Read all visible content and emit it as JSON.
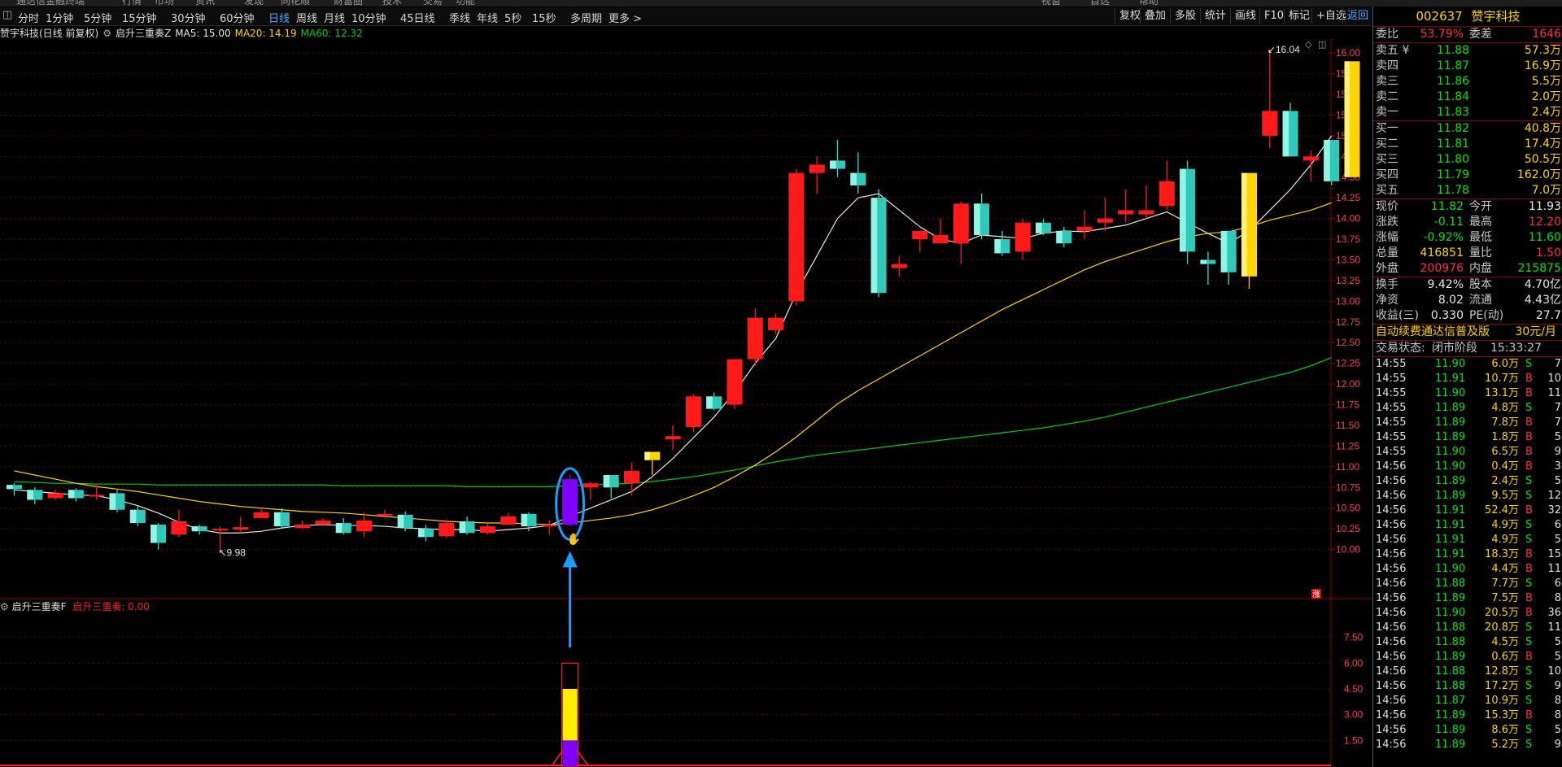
{
  "top_menu": [
    "通达信金融终端",
    "行情",
    "市场",
    "资讯",
    "发现",
    "同花顺",
    "财富圈",
    "技术",
    "交易",
    "功能",
    "视窗",
    "自选",
    "帮助"
  ],
  "toolbar": {
    "tabs": [
      "分时",
      "1分钟",
      "5分钟",
      "15分钟",
      "30分钟",
      "60分钟",
      "日线",
      "周线",
      "月线",
      "10分钟",
      "45日线",
      "季线",
      "年线",
      "5秒",
      "15秒",
      "多周期",
      "更多 >"
    ],
    "active_tab": "日线",
    "right_buttons": [
      "复权",
      "叠加",
      "多股",
      "统计",
      "画线",
      "F10",
      "标记",
      "+自选",
      "返回"
    ],
    "active_right": "返回"
  },
  "chart_info": {
    "stock": "赞宇科技(日线 前复权)",
    "indicator": "启升三重奏Z",
    "ma5": "MA5: 15.00",
    "ma20": "MA20: 14.19",
    "ma60": "MA60: 12.32"
  },
  "sub_info": {
    "name": "启升三重奏F",
    "value": "启升三重奏: 0.00"
  },
  "colors": {
    "up": "#ff1a1a",
    "down": "#33e0c8",
    "signal": "#8000ff",
    "gold": "#ffd400",
    "ma5": "#e8e8e8",
    "ma20": "#ffd400",
    "ma60": "#00d000",
    "highlight": "#1a9fff"
  },
  "chart_data": {
    "type": "candlestick",
    "y_axis_ticks": [
      "16.00",
      "15.75",
      "15.50",
      "15.25",
      "15.00",
      "14.75",
      "14.50",
      "14.25",
      "14.00",
      "13.75",
      "13.50",
      "13.25",
      "13.00",
      "12.75",
      "12.50",
      "12.25",
      "12.00",
      "11.75",
      "11.50",
      "11.25",
      "11.00",
      "10.75",
      "10.50",
      "10.25",
      "10.00"
    ],
    "ylim": [
      9.75,
      16.1
    ],
    "candles": [
      {
        "o": 10.78,
        "h": 10.8,
        "l": 10.65,
        "c": 10.73,
        "k": "down"
      },
      {
        "o": 10.72,
        "h": 10.75,
        "l": 10.55,
        "c": 10.6,
        "k": "down"
      },
      {
        "o": 10.68,
        "h": 10.72,
        "l": 10.6,
        "c": 10.62,
        "k": "up"
      },
      {
        "o": 10.72,
        "h": 10.74,
        "l": 10.58,
        "c": 10.62,
        "k": "down"
      },
      {
        "o": 10.66,
        "h": 10.78,
        "l": 10.6,
        "c": 10.64,
        "k": "up"
      },
      {
        "o": 10.68,
        "h": 10.72,
        "l": 10.45,
        "c": 10.48,
        "k": "down"
      },
      {
        "o": 10.48,
        "h": 10.52,
        "l": 10.28,
        "c": 10.32,
        "k": "down"
      },
      {
        "o": 10.3,
        "h": 10.32,
        "l": 10.0,
        "c": 10.08,
        "k": "down"
      },
      {
        "o": 10.34,
        "h": 10.48,
        "l": 10.15,
        "c": 10.18,
        "k": "up"
      },
      {
        "o": 10.28,
        "h": 10.3,
        "l": 10.18,
        "c": 10.22,
        "k": "down"
      },
      {
        "o": 10.25,
        "h": 10.28,
        "l": 9.98,
        "c": 10.23,
        "k": "up"
      },
      {
        "o": 10.27,
        "h": 10.4,
        "l": 10.2,
        "c": 10.24,
        "k": "up"
      },
      {
        "o": 10.45,
        "h": 10.5,
        "l": 10.38,
        "c": 10.38,
        "k": "up"
      },
      {
        "o": 10.45,
        "h": 10.5,
        "l": 10.25,
        "c": 10.28,
        "k": "down"
      },
      {
        "o": 10.3,
        "h": 10.35,
        "l": 10.25,
        "c": 10.26,
        "k": "up"
      },
      {
        "o": 10.35,
        "h": 10.38,
        "l": 10.3,
        "c": 10.3,
        "k": "up"
      },
      {
        "o": 10.32,
        "h": 10.38,
        "l": 10.18,
        "c": 10.2,
        "k": "down"
      },
      {
        "o": 10.35,
        "h": 10.45,
        "l": 10.15,
        "c": 10.22,
        "k": "up"
      },
      {
        "o": 10.43,
        "h": 10.48,
        "l": 10.38,
        "c": 10.41,
        "k": "up"
      },
      {
        "o": 10.42,
        "h": 10.46,
        "l": 10.22,
        "c": 10.26,
        "k": "down"
      },
      {
        "o": 10.25,
        "h": 10.3,
        "l": 10.1,
        "c": 10.15,
        "k": "down"
      },
      {
        "o": 10.32,
        "h": 10.36,
        "l": 10.14,
        "c": 10.16,
        "k": "up"
      },
      {
        "o": 10.34,
        "h": 10.4,
        "l": 10.18,
        "c": 10.2,
        "k": "down"
      },
      {
        "o": 10.28,
        "h": 10.31,
        "l": 10.18,
        "c": 10.2,
        "k": "up"
      },
      {
        "o": 10.4,
        "h": 10.44,
        "l": 10.3,
        "c": 10.3,
        "k": "up"
      },
      {
        "o": 10.43,
        "h": 10.45,
        "l": 10.22,
        "c": 10.28,
        "k": "down"
      },
      {
        "o": 10.3,
        "h": 10.35,
        "l": 10.18,
        "c": 10.28,
        "k": "up"
      },
      {
        "o": 10.3,
        "h": 10.9,
        "l": 10.28,
        "c": 10.85,
        "k": "signal"
      },
      {
        "o": 10.8,
        "h": 10.82,
        "l": 10.6,
        "c": 10.75,
        "k": "up"
      },
      {
        "o": 10.75,
        "h": 10.88,
        "l": 10.62,
        "c": 10.9,
        "k": "down"
      },
      {
        "o": 10.95,
        "h": 11.05,
        "l": 10.65,
        "c": 10.8,
        "k": "up"
      },
      {
        "o": 11.08,
        "h": 11.18,
        "l": 10.9,
        "c": 11.18,
        "k": "gold"
      },
      {
        "o": 11.33,
        "h": 11.5,
        "l": 11.2,
        "c": 11.37,
        "k": "up"
      },
      {
        "o": 11.48,
        "h": 11.88,
        "l": 11.42,
        "c": 11.85,
        "k": "up"
      },
      {
        "o": 11.85,
        "h": 11.9,
        "l": 11.68,
        "c": 11.7,
        "k": "down"
      },
      {
        "o": 11.75,
        "h": 12.02,
        "l": 11.7,
        "c": 12.3,
        "k": "up"
      },
      {
        "o": 12.3,
        "h": 12.92,
        "l": 12.22,
        "c": 12.8,
        "k": "up"
      },
      {
        "o": 12.8,
        "h": 12.85,
        "l": 12.6,
        "c": 12.65,
        "k": "up"
      },
      {
        "o": 13.0,
        "h": 14.6,
        "l": 12.95,
        "c": 14.55,
        "k": "up"
      },
      {
        "o": 14.55,
        "h": 14.75,
        "l": 14.3,
        "c": 14.65,
        "k": "up"
      },
      {
        "o": 14.7,
        "h": 14.95,
        "l": 14.5,
        "c": 14.6,
        "k": "down"
      },
      {
        "o": 14.55,
        "h": 14.8,
        "l": 14.3,
        "c": 14.4,
        "k": "down"
      },
      {
        "o": 14.25,
        "h": 14.35,
        "l": 13.05,
        "c": 13.1,
        "k": "down"
      },
      {
        "o": 13.4,
        "h": 13.55,
        "l": 13.3,
        "c": 13.45,
        "k": "up"
      },
      {
        "o": 13.75,
        "h": 13.85,
        "l": 13.6,
        "c": 13.85,
        "k": "up"
      },
      {
        "o": 13.8,
        "h": 14.0,
        "l": 13.7,
        "c": 13.7,
        "k": "up"
      },
      {
        "o": 13.7,
        "h": 14.2,
        "l": 13.45,
        "c": 14.18,
        "k": "up"
      },
      {
        "o": 14.18,
        "h": 14.3,
        "l": 13.75,
        "c": 13.8,
        "k": "down"
      },
      {
        "o": 13.75,
        "h": 13.85,
        "l": 13.55,
        "c": 13.58,
        "k": "down"
      },
      {
        "o": 13.6,
        "h": 14.0,
        "l": 13.5,
        "c": 13.95,
        "k": "up"
      },
      {
        "o": 13.95,
        "h": 14.0,
        "l": 13.8,
        "c": 13.82,
        "k": "down"
      },
      {
        "o": 13.85,
        "h": 13.9,
        "l": 13.65,
        "c": 13.7,
        "k": "down"
      },
      {
        "o": 13.85,
        "h": 14.1,
        "l": 13.75,
        "c": 13.9,
        "k": "up"
      },
      {
        "o": 13.95,
        "h": 14.25,
        "l": 13.85,
        "c": 14.0,
        "k": "up"
      },
      {
        "o": 14.05,
        "h": 14.35,
        "l": 13.95,
        "c": 14.1,
        "k": "up"
      },
      {
        "o": 14.05,
        "h": 14.4,
        "l": 14.0,
        "c": 14.1,
        "k": "up"
      },
      {
        "o": 14.15,
        "h": 14.7,
        "l": 14.1,
        "c": 14.45,
        "k": "up"
      },
      {
        "o": 14.6,
        "h": 14.7,
        "l": 13.45,
        "c": 13.6,
        "k": "down"
      },
      {
        "o": 13.45,
        "h": 13.6,
        "l": 13.2,
        "c": 13.5,
        "k": "down"
      },
      {
        "o": 13.35,
        "h": 13.85,
        "l": 13.2,
        "c": 13.85,
        "k": "down"
      },
      {
        "o": 13.3,
        "h": 14.55,
        "l": 13.15,
        "c": 14.55,
        "k": "gold"
      },
      {
        "o": 15.0,
        "h": 16.04,
        "l": 14.85,
        "c": 15.3,
        "k": "up"
      },
      {
        "o": 15.3,
        "h": 15.4,
        "l": 14.75,
        "c": 14.75,
        "k": "down"
      },
      {
        "o": 14.7,
        "h": 14.82,
        "l": 14.45,
        "c": 14.75,
        "k": "up"
      },
      {
        "o": 14.45,
        "h": 14.95,
        "l": 14.4,
        "c": 14.95,
        "k": "down"
      },
      {
        "o": 14.5,
        "h": 15.9,
        "l": 14.5,
        "c": 15.9,
        "k": "gold"
      }
    ],
    "ma5": [
      10.72,
      10.7,
      10.68,
      10.66,
      10.65,
      10.6,
      10.53,
      10.44,
      10.33,
      10.24,
      10.2,
      10.2,
      10.22,
      10.26,
      10.29,
      10.3,
      10.29,
      10.29,
      10.28,
      10.26,
      10.25,
      10.24,
      10.24,
      10.22,
      10.24,
      10.26,
      10.29,
      10.4,
      10.5,
      10.6,
      10.7,
      10.88,
      11.1,
      11.35,
      11.6,
      11.9,
      12.25,
      12.55,
      13.1,
      13.55,
      14.0,
      14.25,
      14.3,
      14.1,
      13.9,
      13.75,
      13.7,
      13.8,
      13.78,
      13.76,
      13.82,
      13.85,
      13.84,
      13.88,
      13.92,
      14.0,
      14.08,
      13.95,
      13.82,
      13.7,
      13.85,
      14.1,
      14.35,
      14.65,
      15.0
    ],
    "ma20": [
      10.95,
      10.9,
      10.85,
      10.8,
      10.76,
      10.73,
      10.7,
      10.66,
      10.62,
      10.58,
      10.55,
      10.52,
      10.5,
      10.48,
      10.46,
      10.45,
      10.44,
      10.42,
      10.4,
      10.38,
      10.36,
      10.34,
      10.33,
      10.32,
      10.32,
      10.31,
      10.3,
      10.32,
      10.35,
      10.38,
      10.42,
      10.48,
      10.56,
      10.65,
      10.75,
      10.88,
      11.02,
      11.18,
      11.36,
      11.56,
      11.76,
      11.92,
      12.06,
      12.2,
      12.34,
      12.48,
      12.62,
      12.76,
      12.9,
      13.02,
      13.14,
      13.26,
      13.38,
      13.48,
      13.56,
      13.64,
      13.72,
      13.78,
      13.82,
      13.84,
      13.9,
      13.98,
      14.04,
      14.1,
      14.19
    ],
    "ma60": [
      10.82,
      10.81,
      10.8,
      10.8,
      10.79,
      10.79,
      10.79,
      10.78,
      10.78,
      10.78,
      10.78,
      10.78,
      10.78,
      10.78,
      10.78,
      10.78,
      10.77,
      10.77,
      10.77,
      10.77,
      10.77,
      10.77,
      10.76,
      10.76,
      10.76,
      10.76,
      10.76,
      10.77,
      10.78,
      10.79,
      10.8,
      10.82,
      10.85,
      10.88,
      10.92,
      10.96,
      11.01,
      11.06,
      11.1,
      11.14,
      11.17,
      11.2,
      11.23,
      11.26,
      11.29,
      11.32,
      11.35,
      11.38,
      11.41,
      11.44,
      11.47,
      11.51,
      11.55,
      11.6,
      11.66,
      11.72,
      11.78,
      11.84,
      11.9,
      11.96,
      12.02,
      12.08,
      12.14,
      12.22,
      12.32
    ],
    "annotations": [
      "16.04",
      "9.98"
    ],
    "sub_y_ticks": [
      "7.50",
      "6.00",
      "4.50",
      "3.00",
      "1.50"
    ],
    "sub_ylim": [
      0,
      9
    ],
    "sub_bar": {
      "index": 27,
      "total": 6,
      "yellow": 3,
      "purple": 1.5
    },
    "sub_triangle": {
      "peak": 1.5
    }
  },
  "right_panel": {
    "code": "002637",
    "name": "赞宇科技",
    "weibi_label": "委比",
    "weibi": "53.79%",
    "weicha_label": "委差",
    "weicha": "1646",
    "sell": [
      {
        "label": "卖五 ¥",
        "price": "11.88",
        "vol": "57.3万"
      },
      {
        "label": "卖四",
        "price": "11.87",
        "vol": "16.9万"
      },
      {
        "label": "卖三",
        "price": "11.86",
        "vol": "5.5万"
      },
      {
        "label": "卖二",
        "price": "11.84",
        "vol": "2.0万"
      },
      {
        "label": "卖一",
        "price": "11.83",
        "vol": "2.4万"
      }
    ],
    "buy": [
      {
        "label": "买一",
        "price": "11.82",
        "vol": "40.8万"
      },
      {
        "label": "买二",
        "price": "11.81",
        "vol": "17.4万"
      },
      {
        "label": "买三",
        "price": "11.80",
        "vol": "50.5万"
      },
      {
        "label": "买四",
        "price": "11.79",
        "vol": "162.0万"
      },
      {
        "label": "买五",
        "price": "11.78",
        "vol": "7.0万"
      }
    ],
    "quote": [
      {
        "l": "现价",
        "v": "11.82",
        "vc": "green",
        "l2": "今开",
        "v2": "11.93",
        "v2c": "white"
      },
      {
        "l": "涨跌",
        "v": "-0.11",
        "vc": "green",
        "l2": "最高",
        "v2": "12.20",
        "v2c": "red"
      },
      {
        "l": "涨幅",
        "v": "-0.92%",
        "vc": "green",
        "l2": "最低",
        "v2": "11.60",
        "v2c": "green"
      },
      {
        "l": "总量",
        "v": "416851",
        "vc": "yellow",
        "l2": "量比",
        "v2": "1.50",
        "v2c": "red"
      },
      {
        "l": "外盘",
        "v": "200976",
        "vc": "red",
        "l2": "内盘",
        "v2": "215875",
        "v2c": "green"
      }
    ],
    "stats": [
      {
        "l": "换手",
        "v": "9.42%",
        "l2": "股本",
        "v2": "4.70亿"
      },
      {
        "l": "净资",
        "v": "8.02",
        "l2": "流通",
        "v2": "4.43亿"
      },
      {
        "l": "收益(三)",
        "v": "0.330",
        "l2": "PE(动)",
        "v2": "27.7"
      }
    ],
    "promo": "自动续费通达信普及版",
    "promo_price": "30元/月",
    "status_label": "交易状态:",
    "status_value": "闭市阶段",
    "status_time": "15:33:27",
    "ticks": [
      {
        "t": "14:55",
        "p": "11.90",
        "v": "6.0万",
        "d": "S",
        "n": "7"
      },
      {
        "t": "14:55",
        "p": "11.91",
        "v": "10.7万",
        "d": "B",
        "n": "10"
      },
      {
        "t": "14:55",
        "p": "11.90",
        "v": "13.1万",
        "d": "B",
        "n": "11"
      },
      {
        "t": "14:55",
        "p": "11.89",
        "v": "4.8万",
        "d": "S",
        "n": "7"
      },
      {
        "t": "14:55",
        "p": "11.89",
        "v": "7.8万",
        "d": "B",
        "n": "7"
      },
      {
        "t": "14:55",
        "p": "11.89",
        "v": "1.8万",
        "d": "B",
        "n": "5"
      },
      {
        "t": "14:55",
        "p": "11.90",
        "v": "6.5万",
        "d": "B",
        "n": "9"
      },
      {
        "t": "14:56",
        "p": "11.90",
        "v": "0.4万",
        "d": "B",
        "n": "3"
      },
      {
        "t": "14:56",
        "p": "11.89",
        "v": "2.4万",
        "d": "S",
        "n": "5"
      },
      {
        "t": "14:56",
        "p": "11.89",
        "v": "9.5万",
        "d": "S",
        "n": "12"
      },
      {
        "t": "14:56",
        "p": "11.91",
        "v": "52.4万",
        "d": "B",
        "n": "32"
      },
      {
        "t": "14:56",
        "p": "11.91",
        "v": "4.9万",
        "d": "S",
        "n": "6"
      },
      {
        "t": "14:56",
        "p": "11.91",
        "v": "4.9万",
        "d": "S",
        "n": "5"
      },
      {
        "t": "14:56",
        "p": "11.91",
        "v": "18.3万",
        "d": "B",
        "n": "15"
      },
      {
        "t": "14:56",
        "p": "11.90",
        "v": "4.4万",
        "d": "B",
        "n": "11"
      },
      {
        "t": "14:56",
        "p": "11.88",
        "v": "7.7万",
        "d": "S",
        "n": "6"
      },
      {
        "t": "14:56",
        "p": "11.89",
        "v": "7.5万",
        "d": "B",
        "n": "8"
      },
      {
        "t": "14:56",
        "p": "11.90",
        "v": "20.5万",
        "d": "B",
        "n": "36"
      },
      {
        "t": "14:56",
        "p": "11.88",
        "v": "20.8万",
        "d": "S",
        "n": "11"
      },
      {
        "t": "14:56",
        "p": "11.88",
        "v": "4.5万",
        "d": "S",
        "n": "5"
      },
      {
        "t": "14:56",
        "p": "11.89",
        "v": "0.6万",
        "d": "B",
        "n": "5"
      },
      {
        "t": "14:56",
        "p": "11.88",
        "v": "12.8万",
        "d": "S",
        "n": "10"
      },
      {
        "t": "14:56",
        "p": "11.88",
        "v": "17.2万",
        "d": "S",
        "n": "9"
      },
      {
        "t": "14:56",
        "p": "11.87",
        "v": "10.9万",
        "d": "S",
        "n": "8"
      },
      {
        "t": "14:56",
        "p": "11.89",
        "v": "15.3万",
        "d": "B",
        "n": "8"
      },
      {
        "t": "14:56",
        "p": "11.89",
        "v": "8.6万",
        "d": "S",
        "n": "5"
      },
      {
        "t": "14:56",
        "p": "11.89",
        "v": "5.2万",
        "d": "S",
        "n": "9"
      }
    ]
  }
}
